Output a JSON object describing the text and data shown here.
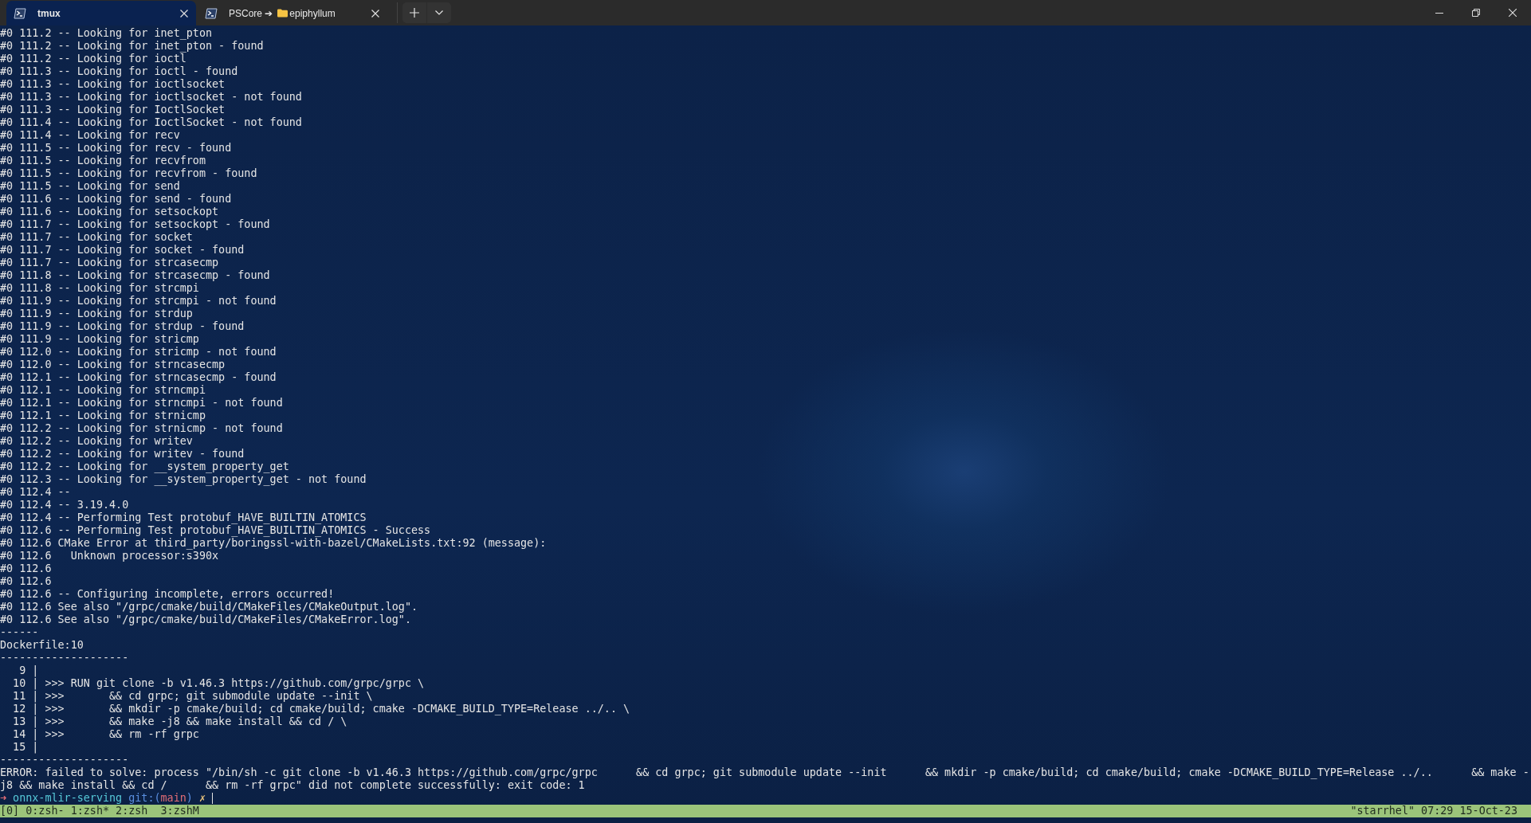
{
  "tabs": [
    {
      "label": "tmux",
      "selected": true
    },
    {
      "label": "PSCore ➔",
      "folder": "epiphyllum",
      "selected": false
    }
  ],
  "terminal": {
    "lines": [
      "#0 111.2 -- Looking for inet_pton",
      "#0 111.2 -- Looking for inet_pton - found",
      "#0 111.2 -- Looking for ioctl",
      "#0 111.3 -- Looking for ioctl - found",
      "#0 111.3 -- Looking for ioctlsocket",
      "#0 111.3 -- Looking for ioctlsocket - not found",
      "#0 111.3 -- Looking for IoctlSocket",
      "#0 111.4 -- Looking for IoctlSocket - not found",
      "#0 111.4 -- Looking for recv",
      "#0 111.5 -- Looking for recv - found",
      "#0 111.5 -- Looking for recvfrom",
      "#0 111.5 -- Looking for recvfrom - found",
      "#0 111.5 -- Looking for send",
      "#0 111.6 -- Looking for send - found",
      "#0 111.6 -- Looking for setsockopt",
      "#0 111.7 -- Looking for setsockopt - found",
      "#0 111.7 -- Looking for socket",
      "#0 111.7 -- Looking for socket - found",
      "#0 111.7 -- Looking for strcasecmp",
      "#0 111.8 -- Looking for strcasecmp - found",
      "#0 111.8 -- Looking for strcmpi",
      "#0 111.9 -- Looking for strcmpi - not found",
      "#0 111.9 -- Looking for strdup",
      "#0 111.9 -- Looking for strdup - found",
      "#0 111.9 -- Looking for stricmp",
      "#0 112.0 -- Looking for stricmp - not found",
      "#0 112.0 -- Looking for strncasecmp",
      "#0 112.1 -- Looking for strncasecmp - found",
      "#0 112.1 -- Looking for strncmpi",
      "#0 112.1 -- Looking for strncmpi - not found",
      "#0 112.1 -- Looking for strnicmp",
      "#0 112.2 -- Looking for strnicmp - not found",
      "#0 112.2 -- Looking for writev",
      "#0 112.2 -- Looking for writev - found",
      "#0 112.2 -- Looking for __system_property_get",
      "#0 112.3 -- Looking for __system_property_get - not found",
      "#0 112.4 --",
      "#0 112.4 -- 3.19.4.0",
      "#0 112.4 -- Performing Test protobuf_HAVE_BUILTIN_ATOMICS",
      "#0 112.6 -- Performing Test protobuf_HAVE_BUILTIN_ATOMICS - Success",
      "#0 112.6 CMake Error at third_party/boringssl-with-bazel/CMakeLists.txt:92 (message):",
      "#0 112.6   Unknown processor:s390x",
      "#0 112.6",
      "#0 112.6",
      "#0 112.6 -- Configuring incomplete, errors occurred!",
      "#0 112.6 See also \"/grpc/cmake/build/CMakeFiles/CMakeOutput.log\".",
      "#0 112.6 See also \"/grpc/cmake/build/CMakeFiles/CMakeError.log\".",
      "------",
      "Dockerfile:10",
      "--------------------",
      "   9 |",
      "  10 | >>> RUN git clone -b v1.46.3 https://github.com/grpc/grpc \\",
      "  11 | >>>       && cd grpc; git submodule update --init \\",
      "  12 | >>>       && mkdir -p cmake/build; cd cmake/build; cmake -DCMAKE_BUILD_TYPE=Release ../.. \\",
      "  13 | >>>       && make -j8 && make install && cd / \\",
      "  14 | >>>       && rm -rf grpc",
      "  15 |",
      "--------------------",
      "ERROR: failed to solve: process \"/bin/sh -c git clone -b v1.46.3 https://github.com/grpc/grpc      && cd grpc; git submodule update --init      && mkdir -p cmake/build; cd cmake/build; cmake -DCMAKE_BUILD_TYPE=Release ../..      && make -",
      "j8 && make install && cd /      && rm -rf grpc\" did not complete successfully: exit code: 1"
    ],
    "prompt": [
      {
        "kind": "arrow",
        "text": "➜"
      },
      {
        "kind": "dir",
        "text": " onnx-mlir-serving"
      },
      {
        "kind": "git",
        "text": " git:("
      },
      {
        "kind": "branch",
        "text": "main"
      },
      {
        "kind": "git",
        "text": ")"
      },
      {
        "kind": "dirty",
        "text": " ✗"
      }
    ]
  },
  "status_bar": {
    "left": "[0] 0:zsh- 1:zsh* 2:zsh  3:zshM",
    "right": "\"starrhel\" 07:29 15-Oct-23"
  }
}
